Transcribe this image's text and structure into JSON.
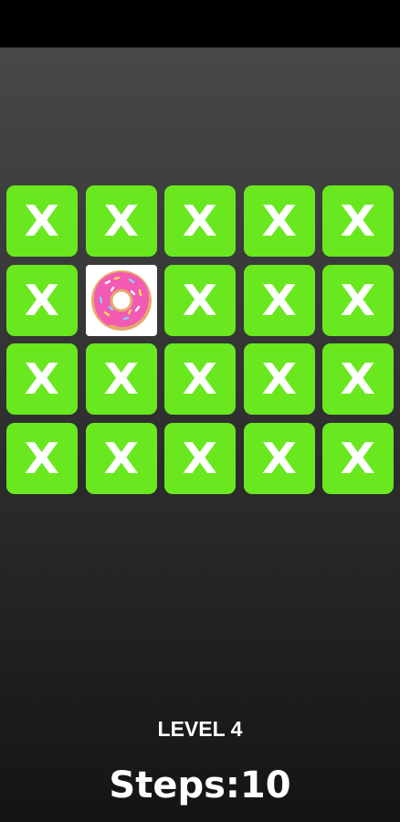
{
  "game": {
    "level_label": "LEVEL 4",
    "steps_label": "Steps:",
    "steps_value": "10"
  },
  "board": {
    "rows": 4,
    "cols": 5,
    "hidden_glyph": "X",
    "tiles": [
      [
        "X",
        "X",
        "X",
        "X",
        "X"
      ],
      [
        "X",
        "donut",
        "X",
        "X",
        "X"
      ],
      [
        "X",
        "X",
        "X",
        "X",
        "X"
      ],
      [
        "X",
        "X",
        "X",
        "X",
        "X"
      ]
    ]
  },
  "colors": {
    "tile_green": "#69e81f",
    "donut_frosting": "#f25ab4",
    "donut_dough": "#e8a86a"
  }
}
